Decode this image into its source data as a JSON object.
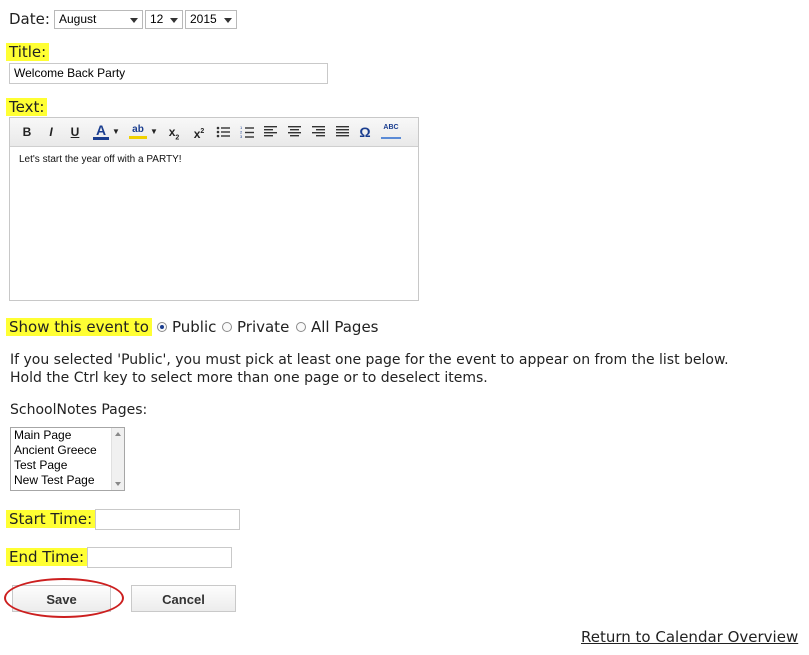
{
  "date": {
    "label": "Date:",
    "month": "August",
    "day": "12",
    "year": "2015"
  },
  "title": {
    "label": "Title:",
    "value": "Welcome Back Party"
  },
  "text": {
    "label": "Text:",
    "toolbar": {
      "bold": "B",
      "italic": "I",
      "underline": "U",
      "font_color": "A",
      "highlight": "ab",
      "subscript": "x",
      "superscript": "x",
      "omega": "Ω",
      "spellcheck": "ABC"
    },
    "body": "Let's start the year off with a PARTY!"
  },
  "visibility": {
    "label": "Show this event to",
    "options": [
      "Public",
      "Private",
      "All Pages"
    ],
    "selected": "Public"
  },
  "instructions": {
    "line1": "If you selected 'Public', you must pick at least one page for the event to appear on from the list below.",
    "line2": "Hold the Ctrl key to select more than one page or to deselect items."
  },
  "pages": {
    "label": "SchoolNotes Pages:",
    "items": [
      "Main Page",
      "Ancient Greece",
      "Test Page",
      "New Test Page"
    ]
  },
  "start_time": {
    "label": "Start Time:",
    "value": ""
  },
  "end_time": {
    "label": "End Time:",
    "value": ""
  },
  "buttons": {
    "save": "Save",
    "cancel": "Cancel"
  },
  "footer": {
    "return_link": "Return to Calendar Overview"
  },
  "colors": {
    "highlight": "#ffff33",
    "save_circle": "#cc1f1f",
    "radio_dot": "#1a3d8f"
  }
}
